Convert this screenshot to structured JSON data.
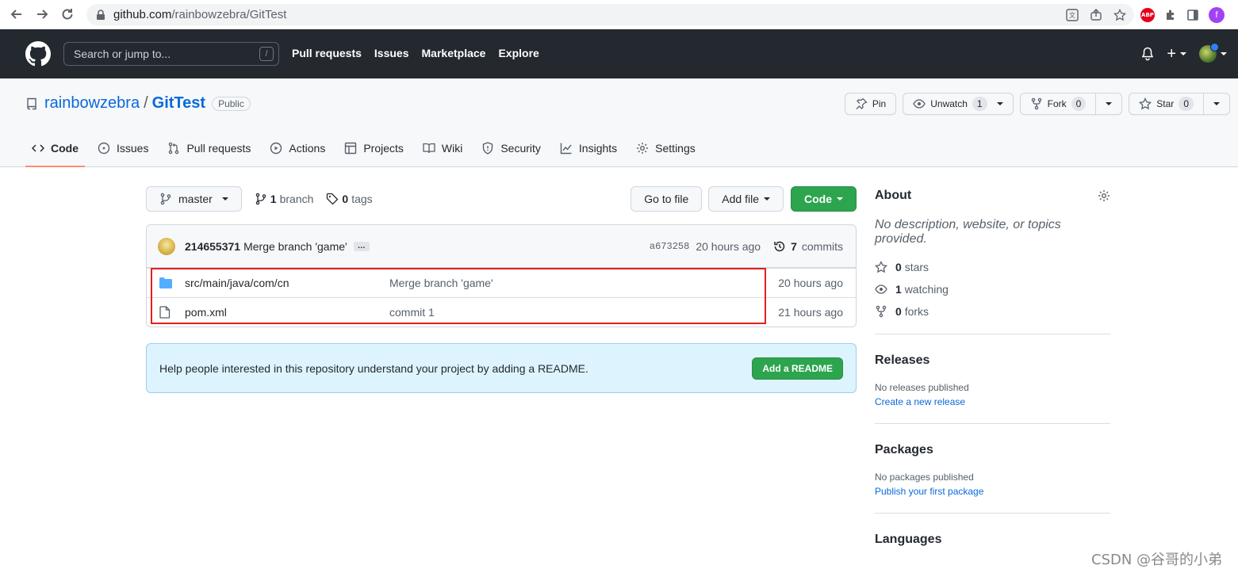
{
  "browser": {
    "url_host": "github.com",
    "url_path": "/rainbowzebra/GitTest",
    "abp_label": "ABP",
    "profile_initial": "f"
  },
  "header": {
    "search_placeholder": "Search or jump to...",
    "search_shortcut": "/",
    "nav": [
      "Pull requests",
      "Issues",
      "Marketplace",
      "Explore"
    ],
    "plus_label": "+"
  },
  "repo": {
    "owner": "rainbowzebra",
    "separator": "/",
    "name": "GitTest",
    "visibility": "Public",
    "pin_label": "Pin",
    "watch_label": "Unwatch",
    "watch_count": "1",
    "fork_label": "Fork",
    "fork_count": "0",
    "star_label": "Star",
    "star_count": "0"
  },
  "tabs": [
    {
      "label": "Code",
      "icon": "code-icon",
      "active": true
    },
    {
      "label": "Issues",
      "icon": "issue-icon"
    },
    {
      "label": "Pull requests",
      "icon": "pull-request-icon"
    },
    {
      "label": "Actions",
      "icon": "play-icon"
    },
    {
      "label": "Projects",
      "icon": "table-icon"
    },
    {
      "label": "Wiki",
      "icon": "book-icon"
    },
    {
      "label": "Security",
      "icon": "shield-icon"
    },
    {
      "label": "Insights",
      "icon": "graph-icon"
    },
    {
      "label": "Settings",
      "icon": "gear-icon"
    }
  ],
  "toolbar": {
    "branch_name": "master",
    "branch_count": "1",
    "branch_label": "branch",
    "tag_count": "0",
    "tag_label": "tags",
    "go_to_file": "Go to file",
    "add_file": "Add file",
    "code_button": "Code"
  },
  "latest_commit": {
    "author": "214655371",
    "message": "Merge branch 'game'",
    "ellipsis": "…",
    "sha": "a673258",
    "age": "20 hours ago",
    "commit_count": "7",
    "commit_label": "commits"
  },
  "files": [
    {
      "type": "folder",
      "name": "src/main/java/com/cn",
      "commit": "Merge branch 'game'",
      "age": "20 hours ago"
    },
    {
      "type": "file",
      "name": "pom.xml",
      "commit": "commit 1",
      "age": "21 hours ago"
    }
  ],
  "readme_prompt": {
    "text": "Help people interested in this repository understand your project by adding a README.",
    "button": "Add a README"
  },
  "sidebar": {
    "about_title": "About",
    "about_desc": "No description, website, or topics provided.",
    "stars_count": "0",
    "stars_label": "stars",
    "watching_count": "1",
    "watching_label": "watching",
    "forks_count": "0",
    "forks_label": "forks",
    "releases_title": "Releases",
    "releases_empty": "No releases published",
    "releases_link": "Create a new release",
    "packages_title": "Packages",
    "packages_empty": "No packages published",
    "packages_link": "Publish your first package",
    "languages_title": "Languages"
  },
  "watermark": "CSDN @谷哥的小弟",
  "colors": {
    "header_bg": "#24292f",
    "link": "#0969da",
    "green": "#2da44e",
    "highlight": "#e0201d",
    "active_tab": "#fd8c73"
  }
}
